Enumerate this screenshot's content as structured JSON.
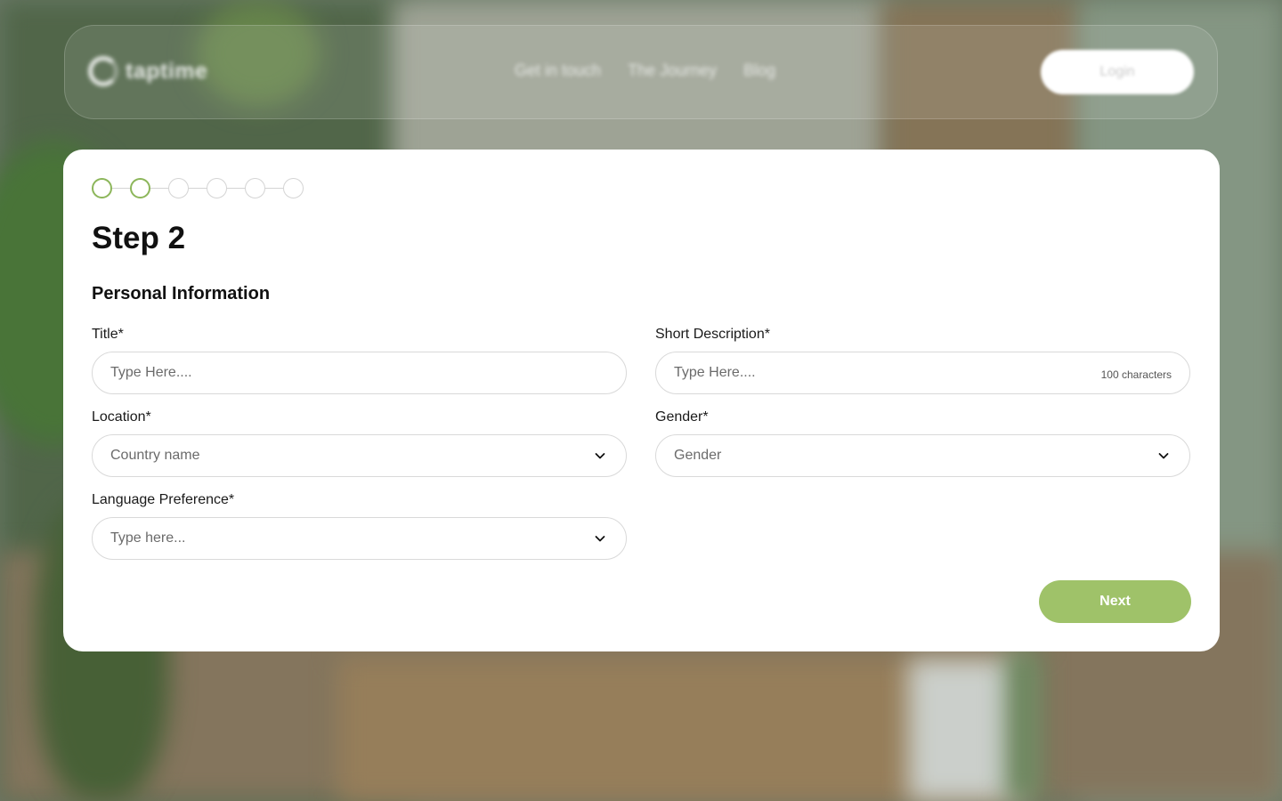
{
  "header": {
    "brand": "taptime",
    "nav": [
      "Get in touch",
      "The Journey",
      "Blog"
    ],
    "login_label": "Login"
  },
  "stepper": {
    "total_steps": 6,
    "current_step": 2
  },
  "form": {
    "step_title": "Step 2",
    "section_title": "Personal Information",
    "title_field": {
      "label": "Title*",
      "placeholder": "Type Here...."
    },
    "short_description": {
      "label": "Short Description*",
      "placeholder": "Type Here....",
      "hint": "100 characters"
    },
    "location": {
      "label": "Location*",
      "value": "Country name"
    },
    "gender": {
      "label": "Gender*",
      "value": "Gender"
    },
    "language": {
      "label": "Language Preference*",
      "value": "Type here..."
    },
    "next_label": "Next"
  },
  "colors": {
    "accent": "#9fc269",
    "step_active": "#8cb65a",
    "border": "#d9d9d9"
  },
  "icons": {
    "dropdown": "chevron-down-icon",
    "logo": "logo-icon"
  }
}
